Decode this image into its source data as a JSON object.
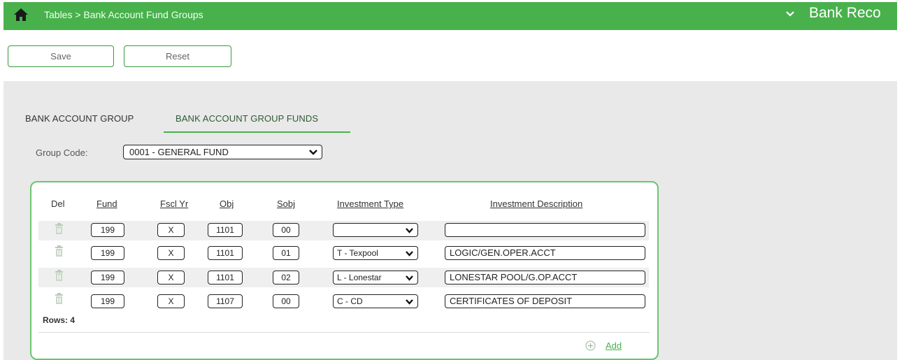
{
  "header": {
    "breadcrumb": "Tables > Bank Account Fund Groups",
    "module_title": "Bank Reco",
    "home_icon": "home-icon",
    "chevron_icon": "chevron-down-icon",
    "accent_color": "#48b14c"
  },
  "toolbar": {
    "save_label": "Save",
    "reset_label": "Reset"
  },
  "tabs": [
    {
      "label": "BANK ACCOUNT GROUP",
      "active": false
    },
    {
      "label": "BANK ACCOUNT GROUP FUNDS",
      "active": true
    }
  ],
  "group_code": {
    "label": "Group Code:",
    "value": "0001 - GENERAL FUND"
  },
  "table": {
    "headers": {
      "del": "Del",
      "fund": "Fund",
      "fscl_yr": "Fscl Yr",
      "obj": "Obj",
      "sobj": "Sobj",
      "investment_type": "Investment Type",
      "investment_description": "Investment Description"
    },
    "rows": [
      {
        "fund": "199",
        "fscl_yr": "X",
        "obj": "1101",
        "sobj": "00",
        "investment_type": "",
        "investment_description": ""
      },
      {
        "fund": "199",
        "fscl_yr": "X",
        "obj": "1101",
        "sobj": "01",
        "investment_type": "T - Texpool",
        "investment_description": "LOGIC/GEN.OPER.ACCT"
      },
      {
        "fund": "199",
        "fscl_yr": "X",
        "obj": "1101",
        "sobj": "02",
        "investment_type": "L - Lonestar",
        "investment_description": "LONESTAR POOL/G.OP.ACCT"
      },
      {
        "fund": "199",
        "fscl_yr": "X",
        "obj": "1107",
        "sobj": "00",
        "investment_type": "C - CD",
        "investment_description": "CERTIFICATES OF DEPOSIT"
      }
    ],
    "rows_label": "Rows: 4"
  },
  "add": {
    "label": "Add",
    "icon": "plus-circle-icon"
  }
}
